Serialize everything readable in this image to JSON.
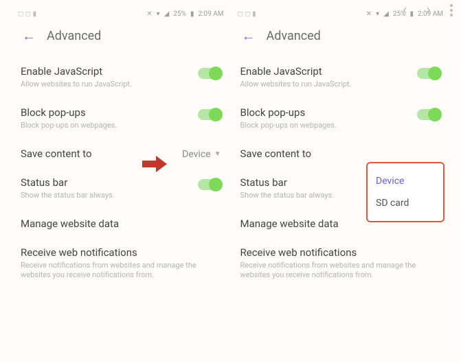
{
  "topnav": {
    "prev": "‹",
    "next": "›"
  },
  "statusbar": {
    "left_icons": "◻ ◻ ▮",
    "mute": "✕",
    "wifi": "▾",
    "signal": "◢",
    "battery_pct": "25%",
    "battery_icon": "▮",
    "time": "2:09 AM"
  },
  "header": {
    "back": "←",
    "title": "Advanced"
  },
  "items": {
    "js": {
      "label": "Enable JavaScript",
      "sub": "Allow websites to run JavaScript."
    },
    "popups": {
      "label": "Block pop-ups",
      "sub": "Block pop-ups on webpages."
    },
    "save": {
      "label": "Save content to",
      "value": "Device"
    },
    "status": {
      "label": "Status bar",
      "sub": "Show the status bar always."
    },
    "manage": {
      "label": "Manage website data"
    },
    "notif": {
      "label": "Receive web notifications",
      "sub": "Receive notifications from websites and manage the websites you receive notifications from."
    }
  },
  "popup": {
    "opt1": "Device",
    "opt2": "SD card"
  }
}
